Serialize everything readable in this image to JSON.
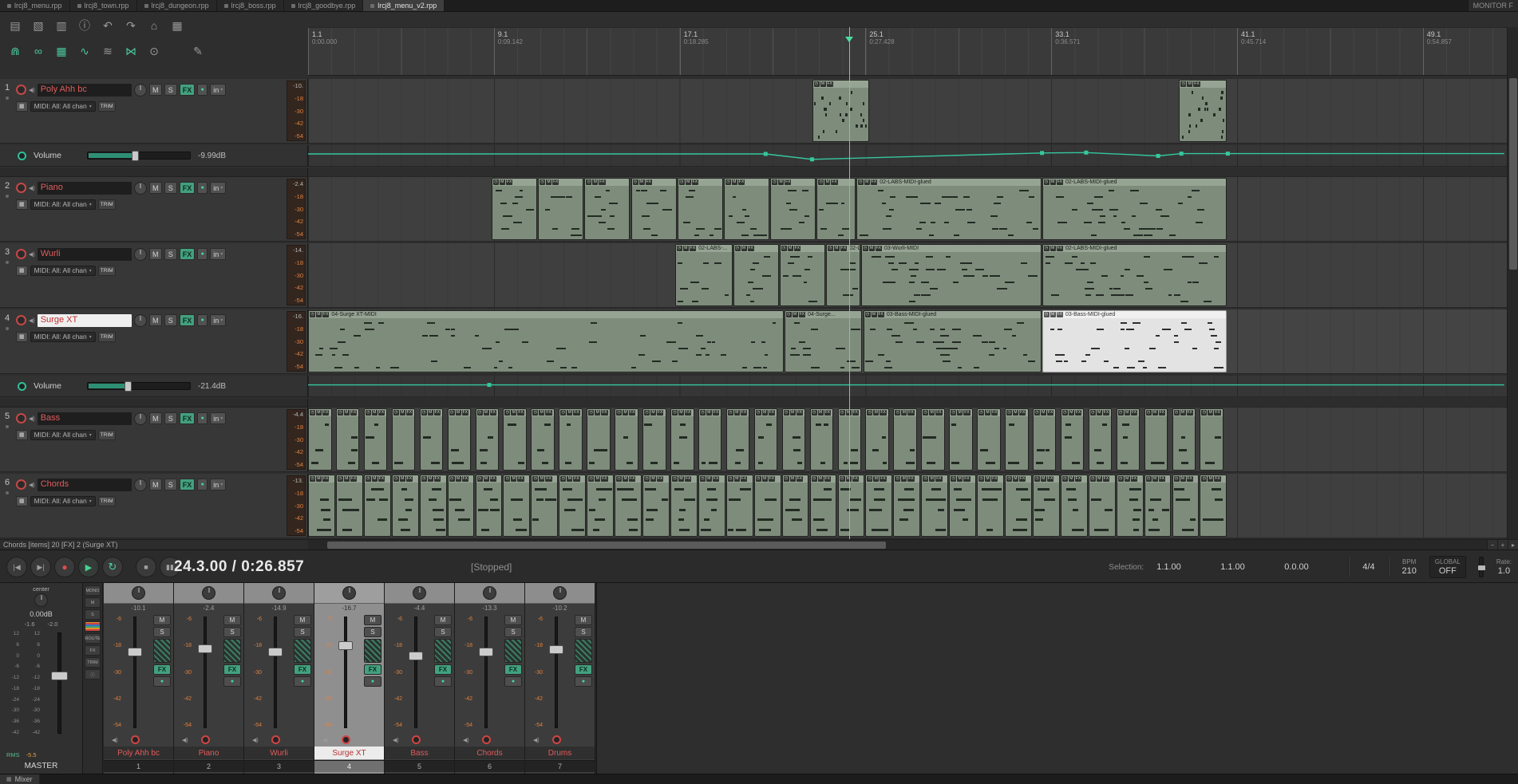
{
  "window": {
    "project_tabs": [
      {
        "label": "lrcj8_menu.rpp",
        "active": false
      },
      {
        "label": "lrcj8_town.rpp",
        "active": false
      },
      {
        "label": "lrcj8_dungeon.rpp",
        "active": false
      },
      {
        "label": "lrcj8_boss.rpp",
        "active": false
      },
      {
        "label": "lrcj8_goodbye.rpp",
        "active": false
      },
      {
        "label": "lrcj8_menu_v2.rpp",
        "active": true
      }
    ],
    "monitor_tab": "MONITOR F"
  },
  "toolbar": {
    "row1": [
      {
        "name": "new-project-icon",
        "glyph": "▤"
      },
      {
        "name": "open-project-icon",
        "glyph": "▧"
      },
      {
        "name": "save-project-icon",
        "glyph": "▥"
      },
      {
        "name": "project-settings-icon",
        "glyph": "ⓘ"
      },
      {
        "name": "undo-icon",
        "glyph": "↶"
      },
      {
        "name": "redo-icon",
        "glyph": "↷"
      },
      {
        "name": "screenset-icon",
        "glyph": "⌂"
      },
      {
        "name": "docker-grid-icon",
        "glyph": "▦"
      }
    ],
    "row2": [
      {
        "name": "snap-toggle-icon",
        "glyph": "⋒",
        "on": true
      },
      {
        "name": "grouping-toggle-icon",
        "glyph": "∞",
        "on": true
      },
      {
        "name": "item-grid-icon",
        "glyph": "▦",
        "on": true
      },
      {
        "name": "envelope-toggle-icon",
        "glyph": "∿",
        "on": true
      },
      {
        "name": "ripple-edit-icon",
        "glyph": "≋",
        "on": false
      },
      {
        "name": "crossfade-toggle-icon",
        "glyph": "⋈",
        "on": true
      },
      {
        "name": "lock-toggle-icon",
        "glyph": "⊙",
        "on": false
      },
      {
        "name": "pencil-tool-icon",
        "glyph": "✎",
        "on": false
      }
    ]
  },
  "ruler_marks": [
    {
      "bar": 1,
      "label": "1.1",
      "time": "0:00.000"
    },
    {
      "bar": 9,
      "label": "9.1",
      "time": "0:09.142"
    },
    {
      "bar": 17,
      "label": "17.1",
      "time": "0:18.285"
    },
    {
      "bar": 25,
      "label": "25.1",
      "time": "0:27.428"
    },
    {
      "bar": 33,
      "label": "33.1",
      "time": "0:36.571"
    },
    {
      "bar": 41,
      "label": "41.1",
      "time": "0:45.714"
    },
    {
      "bar": 49,
      "label": "49.1",
      "time": "0:54.857"
    }
  ],
  "edit_cursor_bar": 24.3,
  "tcp_labels": {
    "mute": "M",
    "solo": "S",
    "fx": "FX",
    "input": "in",
    "midi": "MIDI: All: All chan",
    "trim": "TRIM",
    "meter_scale": [
      "-18",
      "-30",
      "-42",
      "-54"
    ]
  },
  "rows": [
    {
      "type": "track",
      "num": "1",
      "name": "Poly Ahh bc",
      "peak": "-10.",
      "selected": false,
      "note_style": "columns",
      "items": [
        {
          "start": 22.7,
          "len": 2.5,
          "label": ""
        },
        {
          "start": 38.5,
          "len": 2.1,
          "label": ""
        }
      ]
    },
    {
      "type": "envelope",
      "name": "Volume",
      "value": "-9.99dB",
      "slider": 0.47,
      "points": [
        {
          "bar": 1,
          "v": 0.42
        },
        {
          "bar": 20.7,
          "v": 0.42,
          "pt": true
        },
        {
          "bar": 22.7,
          "v": 0.78,
          "pt": true
        },
        {
          "bar": 32.6,
          "v": 0.36,
          "pt": true
        },
        {
          "bar": 34.5,
          "v": 0.33,
          "pt": true
        },
        {
          "bar": 37.6,
          "v": 0.55,
          "pt": true
        },
        {
          "bar": 38.6,
          "v": 0.4,
          "pt": true
        },
        {
          "bar": 40.6,
          "v": 0.4,
          "pt": true
        },
        {
          "bar": 52.5,
          "v": 0.4
        }
      ]
    },
    {
      "type": "spacer"
    },
    {
      "type": "track",
      "num": "2",
      "name": "Piano",
      "peak": "-2.4",
      "selected": false,
      "note_style": "melody",
      "items": [
        {
          "start": 8.9,
          "len": 2
        },
        {
          "start": 10.9,
          "len": 2
        },
        {
          "start": 12.9,
          "len": 2
        },
        {
          "start": 14.9,
          "len": 2
        },
        {
          "start": 16.9,
          "len": 2
        },
        {
          "start": 18.9,
          "len": 2
        },
        {
          "start": 20.9,
          "len": 2
        },
        {
          "start": 22.9,
          "len": 1.7
        },
        {
          "start": 24.6,
          "len": 8,
          "label": "02-LABS-MIDI-glued"
        },
        {
          "start": 32.6,
          "len": 8,
          "label": "02-LABS-MIDI-glued"
        }
      ]
    },
    {
      "type": "track",
      "num": "3",
      "name": "Wurli",
      "peak": "-14.",
      "selected": false,
      "note_style": "melody",
      "items": [
        {
          "start": 16.8,
          "len": 2.5,
          "label": "02-LABS-..."
        },
        {
          "start": 19.3,
          "len": 2
        },
        {
          "start": 21.3,
          "len": 2
        },
        {
          "start": 23.3,
          "len": 1.5,
          "label": "02-LABS-..."
        },
        {
          "start": 24.8,
          "len": 7.8,
          "label": "03-Wurli-MIDI"
        },
        {
          "start": 32.6,
          "len": 8,
          "label": "02-LABS-MIDI-glued"
        }
      ]
    },
    {
      "type": "track",
      "num": "4",
      "name": "Surge XT",
      "peak": "-16.",
      "selected": true,
      "note_style": "melody",
      "items": [
        {
          "start": 1,
          "len": 20.5,
          "label": "04-Surge XT-MIDI"
        },
        {
          "start": 21.5,
          "len": 3.4,
          "label": "04-Surge..."
        },
        {
          "start": 24.9,
          "len": 7.7,
          "label": "03-Bass-MIDI-glued"
        },
        {
          "start": 32.6,
          "len": 8,
          "label": "03-Bass-MIDI-glued",
          "selected": true
        }
      ]
    },
    {
      "type": "envelope",
      "name": "Volume",
      "value": "-21.4dB",
      "slider": 0.4,
      "points": [
        {
          "bar": 1,
          "v": 0.45
        },
        {
          "bar": 8.8,
          "v": 0.45,
          "pt": true
        },
        {
          "bar": 52.5,
          "v": 0.45
        }
      ]
    },
    {
      "type": "spacer"
    },
    {
      "type": "track",
      "num": "5",
      "name": "Bass",
      "peak": "-4.4",
      "selected": false,
      "note_style": "bass",
      "item_repeat": {
        "start": 1,
        "len": 1.05,
        "gap": 0.15,
        "count": 33
      }
    },
    {
      "type": "track",
      "num": "6",
      "name": "Chords",
      "peak": "-13.",
      "selected": false,
      "note_style": "chords",
      "item_repeat": {
        "start": 1,
        "len": 1.2,
        "gap": 0,
        "count": 33
      }
    }
  ],
  "status_bar": "Chords [items] 20 [FX] 2 (Surge XT)",
  "scrollbar": {
    "zoom_in": "+",
    "zoom_out": "−",
    "arrow_right": "▸"
  },
  "transport": {
    "buttons": [
      {
        "name": "go-to-start-button",
        "glyph": "|◀"
      },
      {
        "name": "go-to-end-button",
        "glyph": "▶|"
      },
      {
        "name": "record-button",
        "glyph": "●"
      },
      {
        "name": "play-button",
        "glyph": "▶"
      },
      {
        "name": "repeat-button",
        "glyph": "↻"
      },
      {
        "name": "stop-button",
        "glyph": "■"
      },
      {
        "name": "pause-button",
        "glyph": "▮▮"
      }
    ],
    "time": "24.3.00 / 0:26.857",
    "status": "[Stopped]",
    "selection_label": "Selection:",
    "selection_start": "1.1.00",
    "selection_end": "1.1.00",
    "selection_length": "0.0.00",
    "time_sig": "4/4",
    "bpm_label": "BPM",
    "bpm_value": "210",
    "global_label": "GLOBAL",
    "global_value": "OFF",
    "rate_label": "Rate:",
    "rate_value": "1.0"
  },
  "mixer": {
    "master": {
      "pan_label": "center",
      "gain": "0.00dB",
      "peak_left": "-1.6",
      "peak_right": "-2.0",
      "scale": [
        "12",
        "6",
        "0",
        "-6",
        "-12",
        "-18",
        "-24",
        "-30",
        "-36",
        "-42"
      ],
      "rms_label": "RMS",
      "rms_value": "-5.5",
      "name": "MASTER",
      "fader_frac": 0.42
    },
    "rail": [
      "MONO",
      "M",
      "S",
      "ROUTE",
      "FX",
      "TRIM"
    ],
    "strip_scale": [
      "-6",
      "-18",
      "-30",
      "-42",
      "-54"
    ],
    "strips": [
      {
        "name": "Poly Ahh bc",
        "num": "1",
        "peak": "-10.1",
        "fader": 0.3,
        "selected": false
      },
      {
        "name": "Piano",
        "num": "2",
        "peak": "-2.4",
        "fader": 0.27,
        "selected": false
      },
      {
        "name": "Wurli",
        "num": "3",
        "peak": "-14.9",
        "fader": 0.3,
        "selected": false
      },
      {
        "name": "Surge XT",
        "num": "4",
        "peak": "-16.7",
        "fader": 0.24,
        "selected": true
      },
      {
        "name": "Bass",
        "num": "5",
        "peak": "-4.4",
        "fader": 0.34,
        "selected": false
      },
      {
        "name": "Chords",
        "num": "6",
        "peak": "-13.3",
        "fader": 0.3,
        "selected": false
      },
      {
        "name": "Drums",
        "num": "7",
        "peak": "-10.2",
        "fader": 0.28,
        "selected": false
      }
    ]
  },
  "docker": {
    "tab": "Mixer",
    "icon": "▦"
  }
}
